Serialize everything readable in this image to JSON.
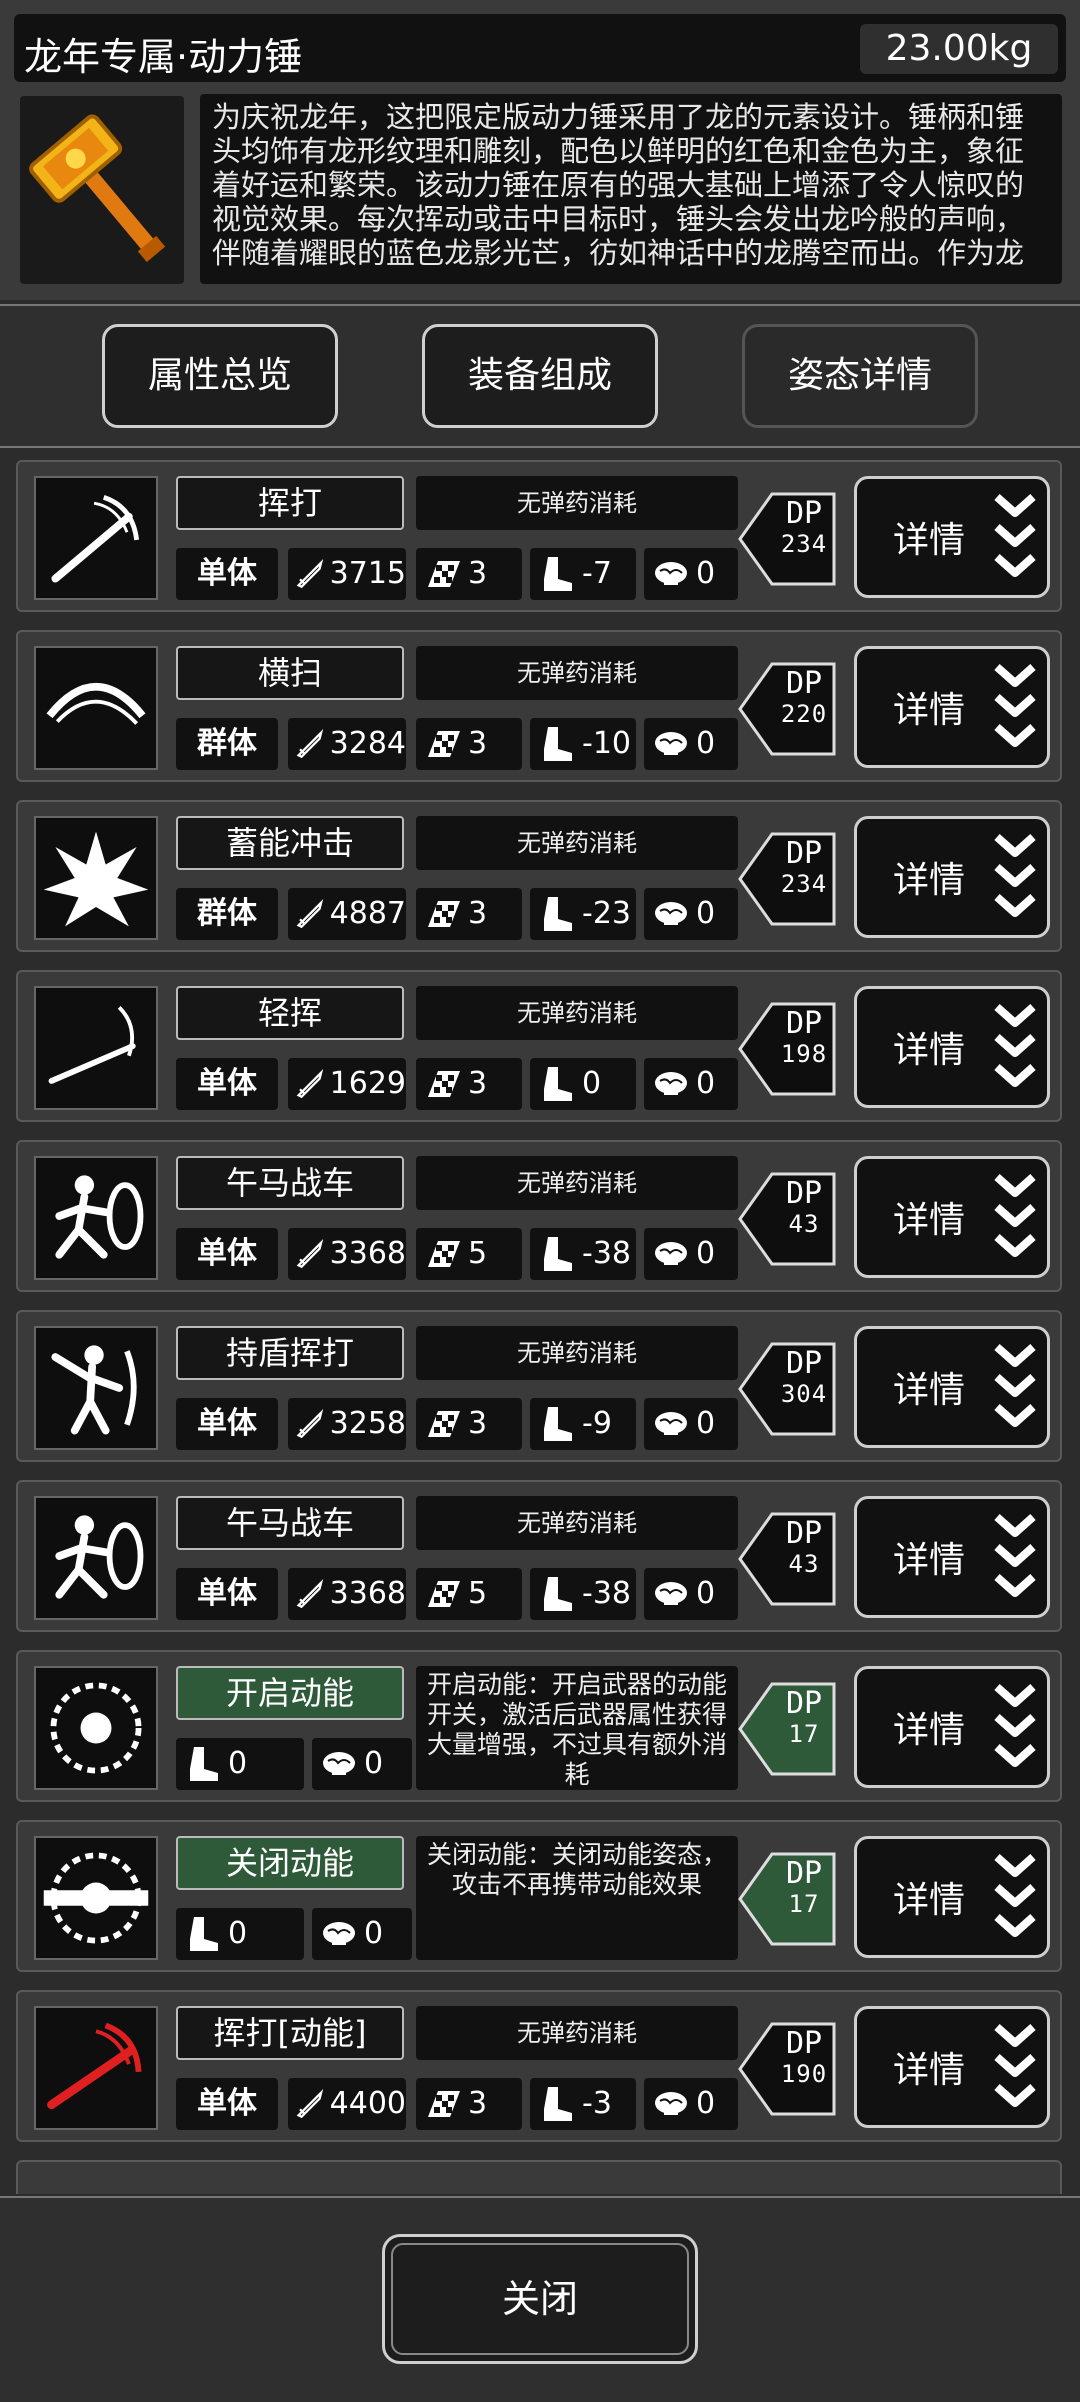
{
  "header": {
    "title": "龙年专属·动力锤",
    "weight": "23.00kg",
    "description": "为庆祝龙年，这把限定版动力锤采用了龙的元素设计。锤柄和锤头均饰有龙形纹理和雕刻，配色以鲜明的红色和金色为主，象征着好运和繁荣。该动力锤在原有的强大基础上增添了令人惊叹的视觉效果。每次挥动或击中目标时，锤头会发出龙吟般的声响，伴随着耀眼的蓝色龙影光芒，彷如神话中的龙腾空而出。作为龙"
  },
  "tabs": [
    "属性总览",
    "装备组成",
    "姿态详情"
  ],
  "moves": [
    {
      "name": "挥打",
      "ammo": "无弹药消耗",
      "target": "单体",
      "damage": "3715",
      "ap": "3",
      "move": "-7",
      "brain": "0",
      "dp_label": "DP",
      "dp": "234",
      "icon": "swing-icon"
    },
    {
      "name": "横扫",
      "ammo": "无弹药消耗",
      "target": "群体",
      "damage": "3284",
      "ap": "3",
      "move": "-10",
      "brain": "0",
      "dp_label": "DP",
      "dp": "220",
      "icon": "sweep-icon"
    },
    {
      "name": "蓄能冲击",
      "ammo": "无弹药消耗",
      "target": "群体",
      "damage": "4887",
      "ap": "3",
      "move": "-23",
      "brain": "0",
      "dp_label": "DP",
      "dp": "234",
      "icon": "explosion-icon"
    },
    {
      "name": "轻挥",
      "ammo": "无弹药消耗",
      "target": "单体",
      "damage": "1629",
      "ap": "3",
      "move": "0",
      "brain": "0",
      "dp_label": "DP",
      "dp": "198",
      "icon": "light-swing-icon"
    },
    {
      "name": "午马战车",
      "ammo": "无弹药消耗",
      "target": "单体",
      "damage": "3368",
      "ap": "5",
      "move": "-38",
      "brain": "0",
      "dp_label": "DP",
      "dp": "43",
      "icon": "shield-charge-icon"
    },
    {
      "name": "持盾挥打",
      "ammo": "无弹药消耗",
      "target": "单体",
      "damage": "3258",
      "ap": "3",
      "move": "-9",
      "brain": "0",
      "dp_label": "DP",
      "dp": "304",
      "icon": "shield-swing-icon"
    },
    {
      "name": "午马战车",
      "ammo": "无弹药消耗",
      "target": "单体",
      "damage": "3368",
      "ap": "5",
      "move": "-38",
      "brain": "0",
      "dp_label": "DP",
      "dp": "43",
      "icon": "shield-charge-icon"
    },
    {
      "name": "开启动能",
      "ammo": "开启动能：开启武器的动能开关，激活后武器属性获得大量增强，不过具有额外消耗",
      "move": "0",
      "brain": "0",
      "dp_label": "DP",
      "dp": "17",
      "icon": "power-on-icon"
    },
    {
      "name": "关闭动能",
      "ammo": "关闭动能：关闭动能姿态，攻击不再携带动能效果",
      "move": "0",
      "brain": "0",
      "dp_label": "DP",
      "dp": "17",
      "icon": "power-off-icon"
    },
    {
      "name": "挥打[动能]",
      "ammo": "无弹药消耗",
      "target": "单体",
      "damage": "4400",
      "ap": "3",
      "move": "-3",
      "brain": "0",
      "dp_label": "DP",
      "dp": "190",
      "icon": "power-swing-icon"
    }
  ],
  "detail_label": "详情",
  "footer": {
    "close": "关闭"
  },
  "colors": {
    "accent_green": "#2e5a3a",
    "background": "#2c2c2c",
    "panel": "#3a3a3a"
  }
}
